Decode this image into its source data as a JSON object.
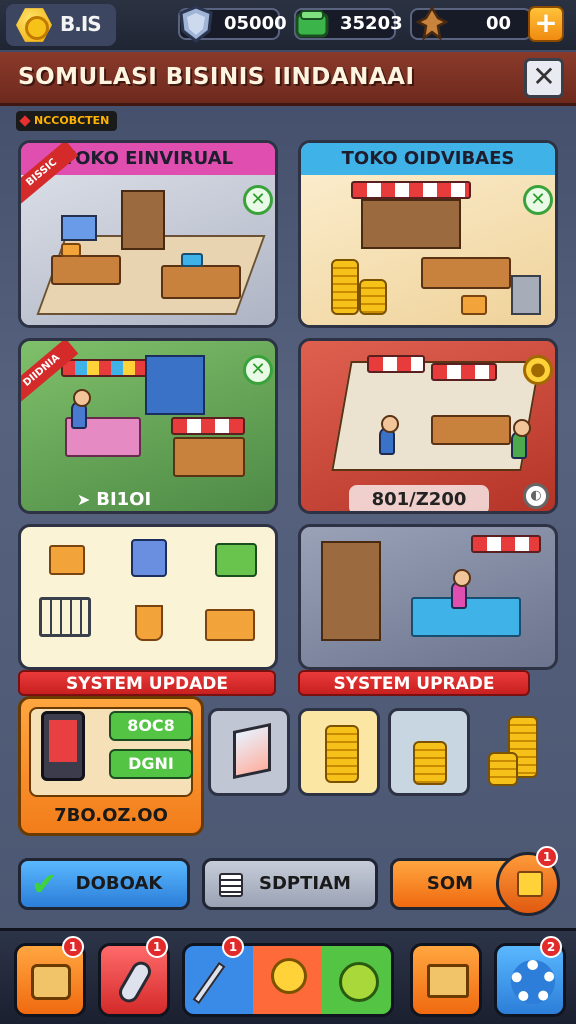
{
  "topbar": {
    "logo_text": "B.IS",
    "resources": [
      {
        "icon": "shield-gem-icon",
        "value": "05000"
      },
      {
        "icon": "green-cash-icon",
        "value": "35203"
      },
      {
        "icon": "trophy-figure-icon",
        "value": "00"
      }
    ],
    "plus_label": "+"
  },
  "title": {
    "text": "SOMULASI BISINIS IINDANAAI",
    "close_label": "✕"
  },
  "tag": "NCCOBCTEN",
  "cards": [
    {
      "head": "TOKO EINVIRUAL",
      "ribbon": "BISSIC",
      "head_color": "#e04fb0"
    },
    {
      "head": "TOKO OIDVIBAES",
      "head_color": "#3fb2e8"
    },
    {
      "ribbon": "DIIDNIA",
      "stat": "BI1OI"
    },
    {
      "stat": "801/Z200"
    }
  ],
  "system_labels": [
    "SYSTEM UPDADE",
    "SYSTEM UPRADE"
  ],
  "upgrade_panel": {
    "btn_top": "8OC8",
    "btn_bottom": "DGNI",
    "value": "7BO.OZ.OO"
  },
  "buttons": {
    "left": "DOBOAK",
    "middle": "SDPTIAM",
    "right": "SOM",
    "right_badge": "1"
  },
  "nav": {
    "items": [
      {
        "icon": "cake-icon",
        "badge": "1"
      },
      {
        "icon": "microphone-icon",
        "badge": "1"
      },
      {
        "icon": "tools-icon",
        "badge": "1"
      },
      {
        "icon": "lamp-figure-icon",
        "badge": ""
      },
      {
        "icon": "coin-icon",
        "badge": ""
      },
      {
        "icon": "folder-icon",
        "badge": ""
      },
      {
        "icon": "gear-icon",
        "badge": "2"
      }
    ]
  }
}
